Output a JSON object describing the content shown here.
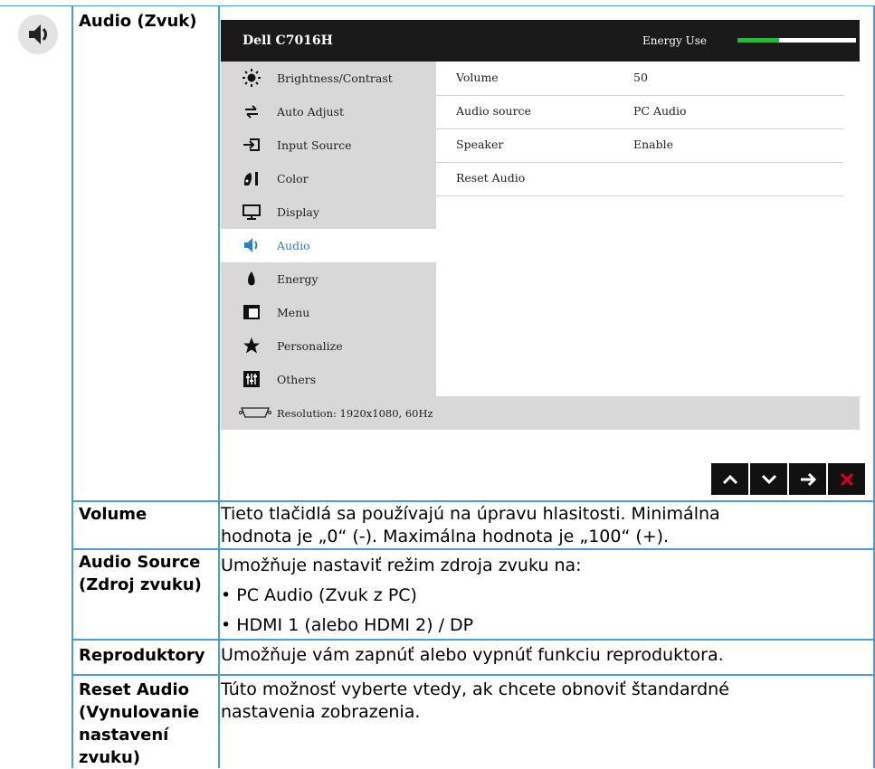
{
  "section": {
    "title": "Audio (Zvuk)",
    "icon": "speaker-icon"
  },
  "osd": {
    "brand": "Dell C7016H",
    "energy_use_label": "Energy Use",
    "energy_level_percent": 35,
    "menu_items": [
      {
        "label": "Brightness/Contrast",
        "icon": "brightness-icon"
      },
      {
        "label": "Auto Adjust",
        "icon": "auto-adjust-icon"
      },
      {
        "label": "Input Source",
        "icon": "input-source-icon"
      },
      {
        "label": "Color",
        "icon": "color-icon"
      },
      {
        "label": "Display",
        "icon": "display-icon"
      },
      {
        "label": "Audio",
        "icon": "audio-icon",
        "active": true
      },
      {
        "label": "Energy",
        "icon": "energy-icon"
      },
      {
        "label": "Menu",
        "icon": "menu-icon"
      },
      {
        "label": "Personalize",
        "icon": "personalize-icon"
      },
      {
        "label": "Others",
        "icon": "others-icon"
      }
    ],
    "settings": [
      {
        "name": "Volume",
        "value": "50"
      },
      {
        "name": "Audio source",
        "value": "PC Audio"
      },
      {
        "name": "Speaker",
        "value": "Enable"
      },
      {
        "name": "Reset Audio",
        "value": ""
      }
    ],
    "resolution": "Resolution: 1920x1080, 60Hz",
    "nav_buttons": [
      "up-arrow-icon",
      "down-arrow-icon",
      "right-arrow-icon",
      "close-icon"
    ],
    "colors": {
      "accent": "#2c7fc9",
      "energy_bar": "#2db63f",
      "close": "#e0001b"
    }
  },
  "rows": [
    {
      "label": "Volume",
      "lines": [
        "Tieto tlačidlá sa používajú na úpravu hlasitosti. Minimálna",
        "hodnota je „0“ (-). Maximálna hodnota je „100“ (+)."
      ]
    },
    {
      "label_lines": [
        "Audio Source",
        "(Zdroj zvuku)"
      ],
      "lines": [
        "Umožňuje nastaviť režim zdroja zvuku na:",
        "• PC Audio (Zvuk z PC)",
        "• HDMI 1 (alebo HDMI 2) / DP"
      ]
    },
    {
      "label": "Reproduktory",
      "lines": [
        "Umožňuje vám zapnúť alebo vypnúť funkciu reproduktora."
      ]
    },
    {
      "label_lines": [
        "Reset Audio",
        "(Vynulovanie",
        "nastavení",
        "zvuku)"
      ],
      "lines": [
        "Túto možnosť vyberte vtedy, ak chcete obnoviť štandardné",
        "nastavenia zobrazenia."
      ]
    }
  ]
}
